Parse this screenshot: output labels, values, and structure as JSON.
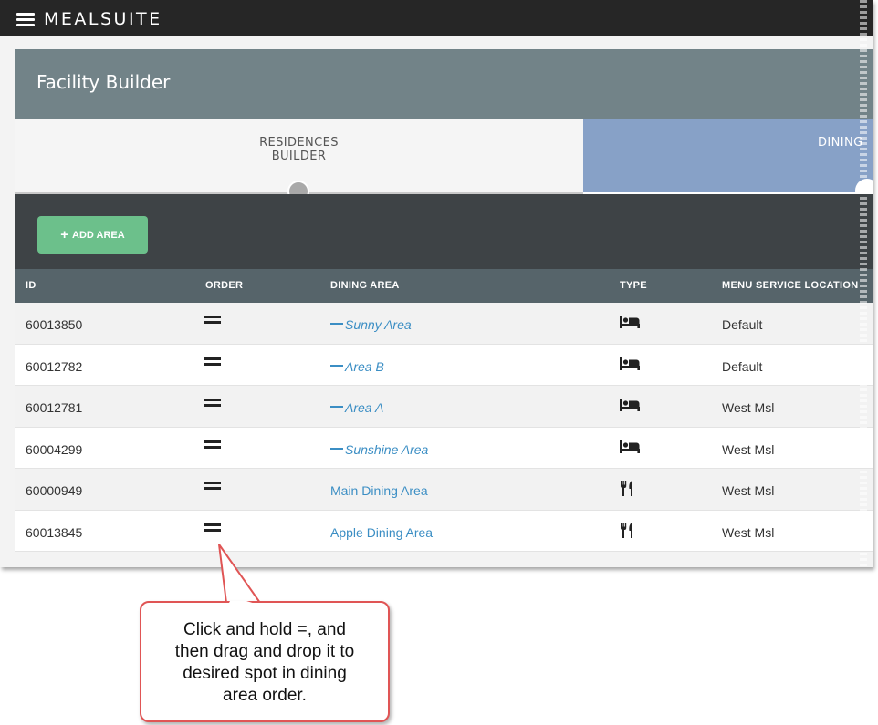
{
  "app": {
    "brand": "MEALSUITE"
  },
  "header": {
    "title": "Facility Builder"
  },
  "steps": [
    {
      "label_line1": "RESIDENCES",
      "label_line2": "BUILDER"
    },
    {
      "label": "DINING"
    }
  ],
  "actions": {
    "add_area_label": "ADD AREA"
  },
  "table": {
    "columns": {
      "id": "ID",
      "order": "ORDER",
      "area": "DINING AREA",
      "type": "TYPE",
      "location": "MENU SERVICE LOCATION"
    },
    "rows": [
      {
        "id": "60013850",
        "area": "Sunny Area",
        "sub": true,
        "type": "bed-icon",
        "location": "Default"
      },
      {
        "id": "60012782",
        "area": "Area B",
        "sub": true,
        "type": "bed-icon",
        "location": "Default"
      },
      {
        "id": "60012781",
        "area": "Area A",
        "sub": true,
        "type": "bed-icon",
        "location": "West Msl"
      },
      {
        "id": "60004299",
        "area": "Sunshine Area",
        "sub": true,
        "type": "bed-icon",
        "location": "West Msl"
      },
      {
        "id": "60000949",
        "area": "Main Dining Area",
        "sub": false,
        "type": "utensils-icon",
        "location": "West Msl"
      },
      {
        "id": "60013845",
        "area": "Apple Dining Area",
        "sub": false,
        "type": "utensils-icon",
        "location": "West Msl"
      }
    ]
  },
  "callout": {
    "lines": [
      "Click and hold =, and",
      "then drag and drop it to",
      "desired spot in dining",
      "area order."
    ]
  },
  "colors": {
    "link": "#3b8ec4",
    "add_button": "#6cc08b",
    "header": "#728388",
    "active_step": "#87a1c7",
    "callout_border": "#e05555"
  }
}
